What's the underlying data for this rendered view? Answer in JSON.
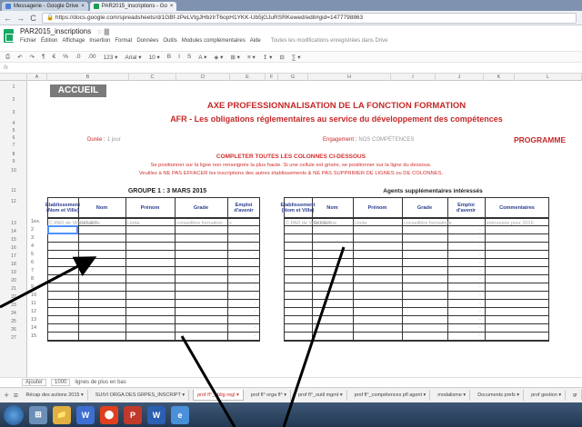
{
  "browser": {
    "tabs": [
      {
        "label": "Messagerie - Google Drive"
      },
      {
        "label": "PAR2015_inscriptions - Go"
      }
    ],
    "url": "https://docs.google.com/spreadsheets/d/1GBf-zPeLVtgJHbzIrT6opH1YKK-Ub5jGJuRSRKewed/edit#gid=1477798863",
    "lock_label": "🔒"
  },
  "doc": {
    "title": "PAR2015_inscriptions",
    "title_icons": "☆ ▇",
    "menus": [
      "Fichier",
      "Édition",
      "Affichage",
      "Insertion",
      "Format",
      "Données",
      "Outils",
      "Modules complémentaires",
      "Aide"
    ],
    "saved_status": "Toutes les modifications enregistrées dans Drive"
  },
  "toolbar": {
    "items": [
      "⎙",
      "↶",
      "↷",
      "¶",
      "€",
      "%",
      ".0",
      ".00",
      "123 ▾",
      "Arial ▾",
      "10 ▾",
      "B",
      "I",
      "S",
      "A ▾",
      "◈ ▾",
      "⊞ ▾",
      "≡ ▾",
      "↥ ▾",
      "⊟",
      "∑ ▾"
    ]
  },
  "formula": {
    "label": "fx"
  },
  "columns": [
    "A",
    "B",
    "C",
    "D",
    "E",
    "F",
    "G",
    "H",
    "I",
    "J",
    "K",
    "L",
    "M"
  ],
  "rows": [
    "1",
    "2",
    "3",
    "4",
    "5",
    "6",
    "7",
    "8",
    "9",
    "10",
    "11",
    "12",
    "13",
    "14",
    "15",
    "16",
    "17",
    "18",
    "19",
    "20",
    "21",
    "22",
    "23",
    "24",
    "25",
    "26",
    "27"
  ],
  "sheet": {
    "accueil": "ACCUEIL",
    "title_line1": "AXE PROFESSIONNALISATION DE LA FONCTION FORMATION",
    "title_line2": "AFR - Les obligations réglementaires au service du développement des compétences",
    "duree_label": "Durée :",
    "duree_value": "1 jour",
    "engagement_label": "Engagement :",
    "engagement_value": "NOS COMPÉTENCES",
    "programme": "PROGRAMME",
    "completer": "COMPLETER TOUTES LES COLONNES CI-DESSOUS",
    "instruction1": "Se positionner sur la ligne non renseignée la plus haute. Si une cellule est grisée, se positionner sur la ligne du dessous.",
    "instruction2": "Veuillez à NE PAS EFFACER les inscriptions des autres établissements & NE PAS SUPPRIMER DE LIGNES ou DE COLONNES.",
    "group1_title": "GROUPE 1 : 3 MARS 2015",
    "agents_title": "Agents supplémentaires intéressés",
    "group1_headers": [
      "Etablissement (Nom et Ville)",
      "Nom",
      "Prénom",
      "Grade",
      "Emploi d'avenir"
    ],
    "agents_headers": [
      "Etablissement (Nom et Ville)",
      "Nom",
      "Prénom",
      "Grade",
      "Emploi d'avenir",
      "Commentaires"
    ],
    "row_numbers": [
      "1ex.",
      "2",
      "3",
      "4",
      "5",
      "6",
      "7",
      "8",
      "9",
      "10",
      "11",
      "12",
      "13",
      "14",
      "15"
    ],
    "example_row_group1": [
      "C.PAD de Villeurbanne",
      "DOUET",
      "Linda",
      "conseillère formation",
      "x"
    ],
    "example_row_agents": [
      "C.PAD de Villeurbanne",
      "DOUET",
      "Linda",
      "conseillère formation",
      "x",
      "intéressée pour 2016"
    ],
    "dash": "-"
  },
  "bottom": {
    "label": "Ajouter",
    "count": "1000",
    "suffix": "lignes de plus en bas"
  },
  "sheet_tabs": [
    "+",
    "≡",
    "Récap des actions 2015 ▾",
    "SUIVI ORGA DES GRPES_INSCRIPT ▾",
    "prof fl°_oblig regl ▾",
    "prof fl° orga fl° ▾",
    "prof fl°_outil mgmt ▾",
    "prof fl°_compétences pfl agent ▾",
    "modalisme ▾",
    "Documents prefs ▾",
    "prof gestion ▾",
    "gr"
  ],
  "active_sheet_tab": 4,
  "taskbar": {
    "items": [
      "⊞",
      "📁",
      "W",
      "⬤",
      "P",
      "W",
      "e"
    ]
  },
  "colors": {
    "accent_red": "#c62828",
    "header_blue": "#2a3c8f",
    "sheets_green": "#16a765",
    "selection_blue": "#4d90fe"
  }
}
